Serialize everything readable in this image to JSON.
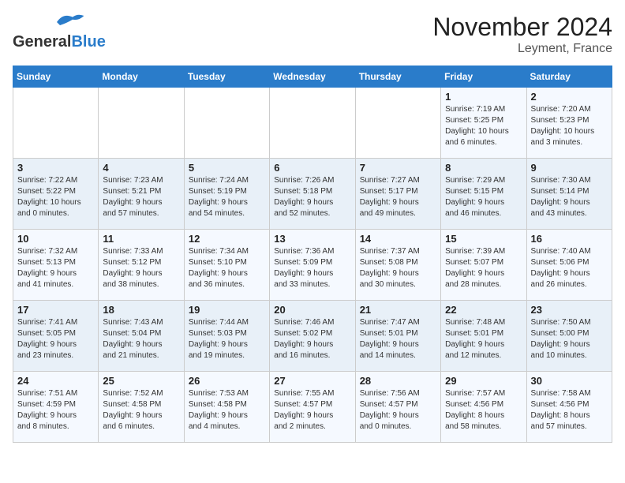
{
  "logo": {
    "text_general": "General",
    "text_blue": "Blue"
  },
  "header": {
    "month": "November 2024",
    "location": "Leyment, France"
  },
  "weekdays": [
    "Sunday",
    "Monday",
    "Tuesday",
    "Wednesday",
    "Thursday",
    "Friday",
    "Saturday"
  ],
  "weeks": [
    [
      {
        "day": "",
        "info": ""
      },
      {
        "day": "",
        "info": ""
      },
      {
        "day": "",
        "info": ""
      },
      {
        "day": "",
        "info": ""
      },
      {
        "day": "",
        "info": ""
      },
      {
        "day": "1",
        "info": "Sunrise: 7:19 AM\nSunset: 5:25 PM\nDaylight: 10 hours\nand 6 minutes."
      },
      {
        "day": "2",
        "info": "Sunrise: 7:20 AM\nSunset: 5:23 PM\nDaylight: 10 hours\nand 3 minutes."
      }
    ],
    [
      {
        "day": "3",
        "info": "Sunrise: 7:22 AM\nSunset: 5:22 PM\nDaylight: 10 hours\nand 0 minutes."
      },
      {
        "day": "4",
        "info": "Sunrise: 7:23 AM\nSunset: 5:21 PM\nDaylight: 9 hours\nand 57 minutes."
      },
      {
        "day": "5",
        "info": "Sunrise: 7:24 AM\nSunset: 5:19 PM\nDaylight: 9 hours\nand 54 minutes."
      },
      {
        "day": "6",
        "info": "Sunrise: 7:26 AM\nSunset: 5:18 PM\nDaylight: 9 hours\nand 52 minutes."
      },
      {
        "day": "7",
        "info": "Sunrise: 7:27 AM\nSunset: 5:17 PM\nDaylight: 9 hours\nand 49 minutes."
      },
      {
        "day": "8",
        "info": "Sunrise: 7:29 AM\nSunset: 5:15 PM\nDaylight: 9 hours\nand 46 minutes."
      },
      {
        "day": "9",
        "info": "Sunrise: 7:30 AM\nSunset: 5:14 PM\nDaylight: 9 hours\nand 43 minutes."
      }
    ],
    [
      {
        "day": "10",
        "info": "Sunrise: 7:32 AM\nSunset: 5:13 PM\nDaylight: 9 hours\nand 41 minutes."
      },
      {
        "day": "11",
        "info": "Sunrise: 7:33 AM\nSunset: 5:12 PM\nDaylight: 9 hours\nand 38 minutes."
      },
      {
        "day": "12",
        "info": "Sunrise: 7:34 AM\nSunset: 5:10 PM\nDaylight: 9 hours\nand 36 minutes."
      },
      {
        "day": "13",
        "info": "Sunrise: 7:36 AM\nSunset: 5:09 PM\nDaylight: 9 hours\nand 33 minutes."
      },
      {
        "day": "14",
        "info": "Sunrise: 7:37 AM\nSunset: 5:08 PM\nDaylight: 9 hours\nand 30 minutes."
      },
      {
        "day": "15",
        "info": "Sunrise: 7:39 AM\nSunset: 5:07 PM\nDaylight: 9 hours\nand 28 minutes."
      },
      {
        "day": "16",
        "info": "Sunrise: 7:40 AM\nSunset: 5:06 PM\nDaylight: 9 hours\nand 26 minutes."
      }
    ],
    [
      {
        "day": "17",
        "info": "Sunrise: 7:41 AM\nSunset: 5:05 PM\nDaylight: 9 hours\nand 23 minutes."
      },
      {
        "day": "18",
        "info": "Sunrise: 7:43 AM\nSunset: 5:04 PM\nDaylight: 9 hours\nand 21 minutes."
      },
      {
        "day": "19",
        "info": "Sunrise: 7:44 AM\nSunset: 5:03 PM\nDaylight: 9 hours\nand 19 minutes."
      },
      {
        "day": "20",
        "info": "Sunrise: 7:46 AM\nSunset: 5:02 PM\nDaylight: 9 hours\nand 16 minutes."
      },
      {
        "day": "21",
        "info": "Sunrise: 7:47 AM\nSunset: 5:01 PM\nDaylight: 9 hours\nand 14 minutes."
      },
      {
        "day": "22",
        "info": "Sunrise: 7:48 AM\nSunset: 5:01 PM\nDaylight: 9 hours\nand 12 minutes."
      },
      {
        "day": "23",
        "info": "Sunrise: 7:50 AM\nSunset: 5:00 PM\nDaylight: 9 hours\nand 10 minutes."
      }
    ],
    [
      {
        "day": "24",
        "info": "Sunrise: 7:51 AM\nSunset: 4:59 PM\nDaylight: 9 hours\nand 8 minutes."
      },
      {
        "day": "25",
        "info": "Sunrise: 7:52 AM\nSunset: 4:58 PM\nDaylight: 9 hours\nand 6 minutes."
      },
      {
        "day": "26",
        "info": "Sunrise: 7:53 AM\nSunset: 4:58 PM\nDaylight: 9 hours\nand 4 minutes."
      },
      {
        "day": "27",
        "info": "Sunrise: 7:55 AM\nSunset: 4:57 PM\nDaylight: 9 hours\nand 2 minutes."
      },
      {
        "day": "28",
        "info": "Sunrise: 7:56 AM\nSunset: 4:57 PM\nDaylight: 9 hours\nand 0 minutes."
      },
      {
        "day": "29",
        "info": "Sunrise: 7:57 AM\nSunset: 4:56 PM\nDaylight: 8 hours\nand 58 minutes."
      },
      {
        "day": "30",
        "info": "Sunrise: 7:58 AM\nSunset: 4:56 PM\nDaylight: 8 hours\nand 57 minutes."
      }
    ]
  ]
}
